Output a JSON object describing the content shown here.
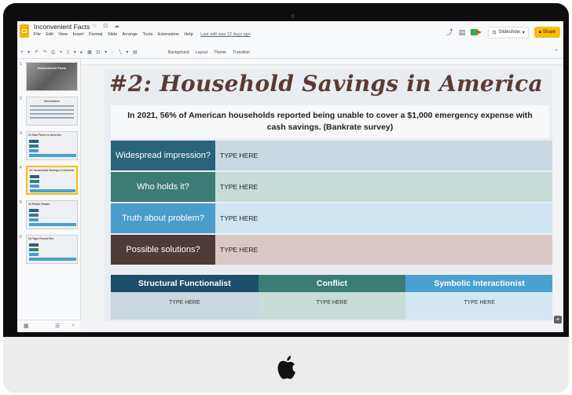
{
  "app": {
    "doc_title": "Inconvenient Facts",
    "menu": [
      "File",
      "Edit",
      "View",
      "Insert",
      "Format",
      "Slide",
      "Arrange",
      "Tools",
      "Extensions",
      "Help"
    ],
    "last_edit": "Last edit was 12 days ago",
    "slideshow_label": "Slideshow",
    "share_label": "Share"
  },
  "toolbar": {
    "labels": [
      "Background",
      "Layout",
      "Theme",
      "Transition"
    ]
  },
  "filmstrip": {
    "slides": [
      {
        "num": "1",
        "title": "Inconvenient Facts"
      },
      {
        "num": "2",
        "title": "Directions"
      },
      {
        "num": "3",
        "title": "#1 Gas Prices in America"
      },
      {
        "num": "4",
        "title": "#2: Household Savings in America"
      },
      {
        "num": "5",
        "title": "#3 Public Roads"
      },
      {
        "num": "6",
        "title": "#4 Tiger Forest Fire"
      }
    ],
    "active_index": 3
  },
  "slide": {
    "title": "#2: Household Savings in America",
    "stat": "In 2021, 56% of American households reported being unable to cover a $1,000 emergency expense with cash savings. (Bankrate survey)",
    "questions": [
      {
        "label": "Widespread impression?",
        "value": "TYPE HERE"
      },
      {
        "label": "Who holds it?",
        "value": "TYPE HERE"
      },
      {
        "label": "Truth about problem?",
        "value": "TYPE HERE"
      },
      {
        "label": "Possible solutions?",
        "value": "TYPE HERE"
      }
    ],
    "perspectives": [
      {
        "label": "Structural Functionalist",
        "value": "TYPE HERE"
      },
      {
        "label": "Conflict",
        "value": "TYPE HERE"
      },
      {
        "label": "Symbolic Interactionist",
        "value": "TYPE HERE"
      }
    ]
  },
  "colors": {
    "title_brown": "#5a3b34",
    "q1_label": "#2a6279",
    "q1_value": "#c9d8e0",
    "q2_label": "#3b7d74",
    "q2_value": "#c6ddd8",
    "q3_label": "#4a9ccb",
    "q3_value": "#cfe5f2",
    "q4_label": "#4e3a37",
    "q4_value": "#d9c8c6",
    "p1_head": "#1f4e6a",
    "p1_body": "#c9d8e0",
    "p2_head": "#3b7d74",
    "p2_body": "#c6ddd8",
    "p3_head": "#4aa1d0",
    "p3_body": "#d3e7f3",
    "share_yellow": "#fbbc04"
  }
}
